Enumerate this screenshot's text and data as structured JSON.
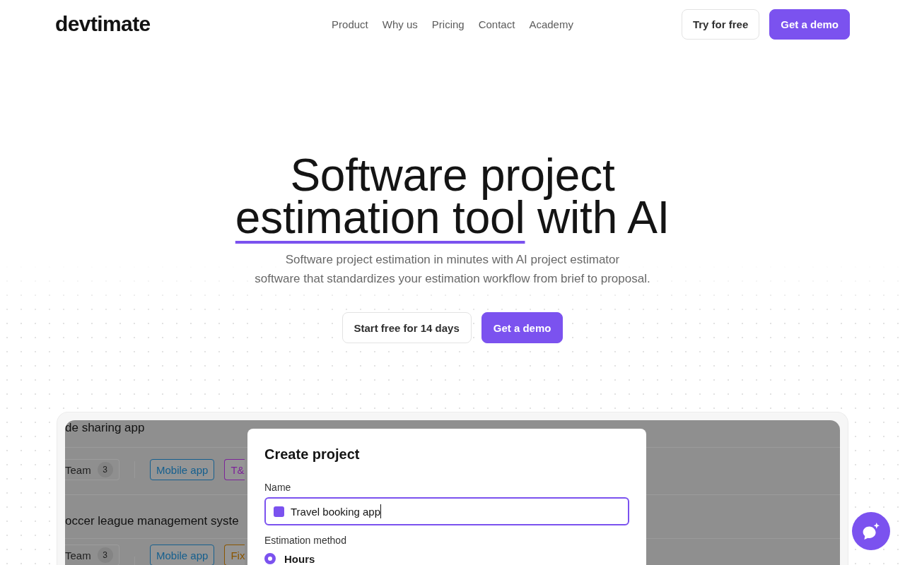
{
  "header": {
    "logo": "devtimate",
    "nav": [
      {
        "label": "Product"
      },
      {
        "label": "Why us"
      },
      {
        "label": "Pricing"
      },
      {
        "label": "Contact"
      },
      {
        "label": "Academy"
      }
    ],
    "buttons": [
      {
        "label": "Try for free",
        "kind": "outline"
      },
      {
        "label": "Get a demo",
        "kind": "primary"
      }
    ]
  },
  "hero": {
    "title": [
      {
        "text": "Software project",
        "underlined": false
      },
      {
        "text": "estimation tool",
        "underlined": true
      },
      {
        "text": "with AI",
        "underlined": false
      }
    ],
    "subtitle_lines": [
      "Software project estimation in minutes with AI project estimator",
      "software that standardizes your estimation workflow from brief to proposal."
    ],
    "buttons": [
      {
        "label": "Start free for 14 days",
        "kind": "outline"
      },
      {
        "label": "Get a demo",
        "kind": "primary"
      }
    ]
  },
  "preview": {
    "projects": [
      {
        "title": "de sharing app",
        "team": {
          "label": "Team",
          "count": "3"
        },
        "tags": [
          {
            "label": "Mobile app",
            "color": "#155f8e"
          },
          {
            "label": "T&",
            "color": "#7d2399"
          }
        ]
      },
      {
        "title": "occer league management syste",
        "team": {
          "label": "Team",
          "count": "3"
        },
        "tags": [
          {
            "label": "Mobile app",
            "color": "#155f8e"
          },
          {
            "label": "Fix",
            "color": "#8a5500"
          }
        ]
      }
    ],
    "dialog": {
      "title": "Create project",
      "name_label": "Name",
      "name_value": "Travel booking app",
      "method_label": "Estimation method",
      "methods": [
        {
          "label": "Hours",
          "selected": true
        }
      ]
    }
  }
}
